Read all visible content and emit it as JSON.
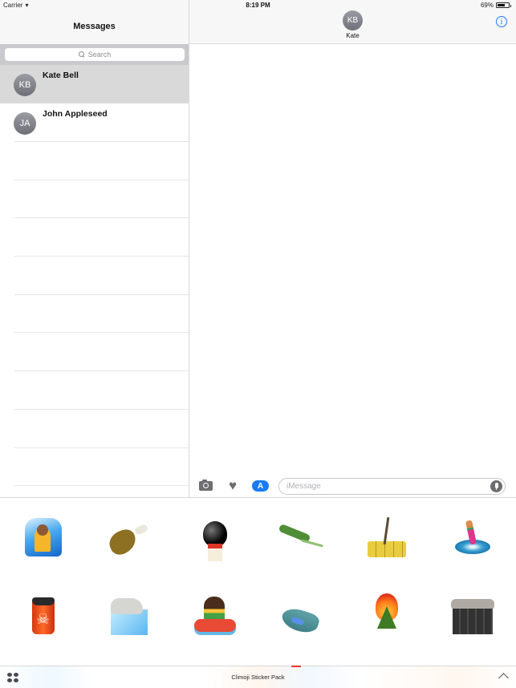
{
  "status_bar": {
    "carrier": "Carrier",
    "time": "8:19 PM",
    "battery_percent_label": "69%",
    "battery_level": 0.69
  },
  "sidebar": {
    "title": "Messages",
    "search_placeholder": "Search",
    "conversations": [
      {
        "initials": "KB",
        "name": "Kate Bell",
        "selected": true
      },
      {
        "initials": "JA",
        "name": "John Appleseed",
        "selected": false
      }
    ]
  },
  "conversation": {
    "contact_initials": "KB",
    "contact_name": "Kate",
    "info_label": "i"
  },
  "compose": {
    "placeholder": "iMessage",
    "icons": [
      "camera-icon",
      "digital-touch-heart-icon",
      "app-store-icon",
      "microphone-icon"
    ]
  },
  "sticker_drawer": {
    "stickers": [
      {
        "name": "person-in-wave"
      },
      {
        "name": "rotten-drumstick"
      },
      {
        "name": "garbage-bag-on-house"
      },
      {
        "name": "dead-lizard"
      },
      {
        "name": "dead-tree-dry-soil"
      },
      {
        "name": "drowning-hand"
      },
      {
        "name": "toxic-barrel"
      },
      {
        "name": "polar-bear-on-ice"
      },
      {
        "name": "woman-on-life-raft"
      },
      {
        "name": "whale-eating-plastic-bottle"
      },
      {
        "name": "burning-tree"
      },
      {
        "name": "polluting-factory"
      }
    ]
  },
  "app_strip": {
    "title": "Climoji Sticker Pack"
  }
}
